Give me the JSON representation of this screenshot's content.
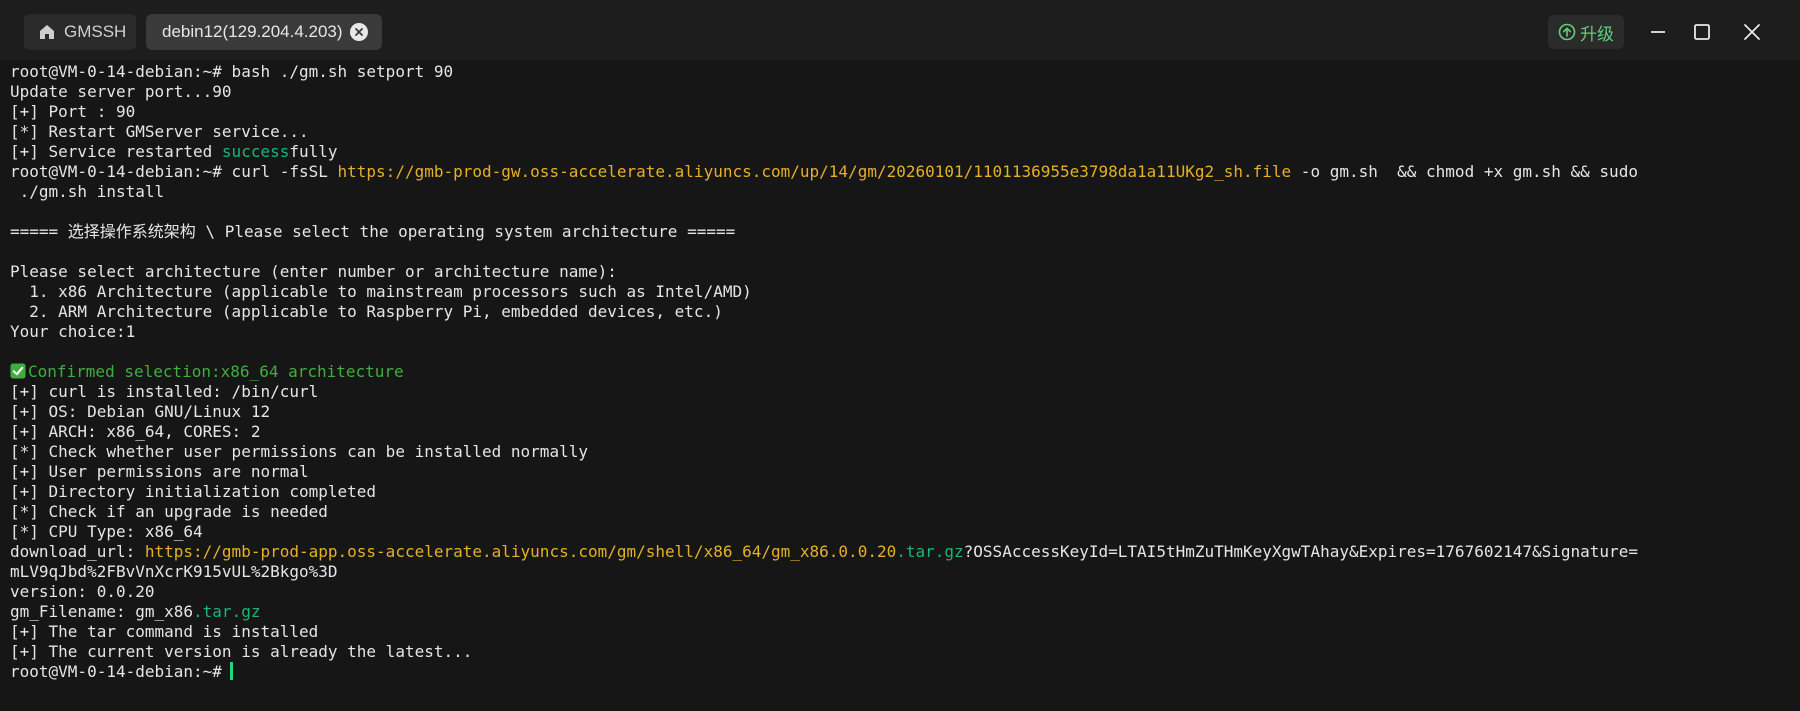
{
  "tabs": [
    {
      "label": "GMSSH",
      "icon": "home-icon"
    },
    {
      "label": "debin12(129.204.4.203)",
      "active": true
    }
  ],
  "toolbar": {
    "upgrade_label": "升级",
    "upgrade_color": "#5fd07a"
  },
  "colors": {
    "background": "#161616",
    "text": "#e5e5e5",
    "url": "#e5b027",
    "highlight_green": "#19b57a",
    "confirm_green": "#3fae3f",
    "cursor": "#1fd67f"
  },
  "terminal": {
    "lines": [
      {
        "segments": [
          {
            "text": "root@VM-0-14-debian:~# bash ./gm.sh setport 90"
          }
        ]
      },
      {
        "segments": [
          {
            "text": "Update server port...90"
          }
        ]
      },
      {
        "segments": [
          {
            "text": "[+] Port : 90"
          }
        ]
      },
      {
        "segments": [
          {
            "text": "[*] Restart GMServer service..."
          }
        ]
      },
      {
        "segments": [
          {
            "text": "[+] Service restarted "
          },
          {
            "text": "success",
            "style": "green"
          },
          {
            "text": "fully"
          }
        ]
      },
      {
        "segments": [
          {
            "text": "root@VM-0-14-debian:~# curl -fsSL "
          },
          {
            "text": "https://gmb-prod-gw.oss-accelerate.aliyuncs.com/up/14/gm/20260101/1101136955e3798da1a11UKg2_sh.file",
            "style": "url"
          },
          {
            "text": " -o gm.sh  && chmod +x gm.sh && sudo"
          }
        ]
      },
      {
        "segments": [
          {
            "text": " ./gm.sh install"
          }
        ]
      },
      {
        "segments": [
          {
            "text": ""
          }
        ]
      },
      {
        "segments": [
          {
            "text": "===== 选择操作系统架构 \\ Please select the operating system architecture ====="
          }
        ]
      },
      {
        "segments": [
          {
            "text": ""
          }
        ]
      },
      {
        "segments": [
          {
            "text": "Please select architecture (enter number or architecture name):"
          }
        ]
      },
      {
        "segments": [
          {
            "text": "  1. x86 Architecture (applicable to mainstream processors such as Intel/AMD)"
          }
        ]
      },
      {
        "segments": [
          {
            "text": "  2. ARM Architecture (applicable to Raspberry Pi, embedded devices, etc.)"
          }
        ]
      },
      {
        "segments": [
          {
            "text": "Your choice:1"
          }
        ]
      },
      {
        "segments": [
          {
            "text": ""
          }
        ]
      },
      {
        "icon": "check-mark-icon",
        "segments": [
          {
            "text": "Confirmed selection:x86_64 architecture",
            "style": "confirm"
          }
        ]
      },
      {
        "segments": [
          {
            "text": "[+] curl is installed: /bin/curl"
          }
        ]
      },
      {
        "segments": [
          {
            "text": "[+] OS: Debian GNU/Linux 12"
          }
        ]
      },
      {
        "segments": [
          {
            "text": "[+] ARCH: x86_64, CORES: 2"
          }
        ]
      },
      {
        "segments": [
          {
            "text": "[*] Check whether user permissions can be installed normally"
          }
        ]
      },
      {
        "segments": [
          {
            "text": "[+] User permissions are normal"
          }
        ]
      },
      {
        "segments": [
          {
            "text": "[+] Directory initialization completed"
          }
        ]
      },
      {
        "segments": [
          {
            "text": "[*] Check if an upgrade is needed"
          }
        ]
      },
      {
        "segments": [
          {
            "text": "[*] CPU Type: x86_64"
          }
        ]
      },
      {
        "segments": [
          {
            "text": "download_url: "
          },
          {
            "text": "https://gmb-prod-app.oss-accelerate.aliyuncs.com/gm/shell/x86_64/gm_x86.0.0.20",
            "style": "url"
          },
          {
            "text": ".tar.gz",
            "style": "green"
          },
          {
            "text": "?OSSAccessKeyId=LTAI5tHmZuTHmKeyXgwTAhay&Expires=1767602147&Signature="
          }
        ]
      },
      {
        "segments": [
          {
            "text": "mLV9qJbd%2FBvVnXcrK915vUL%2Bkgo%3D"
          }
        ]
      },
      {
        "segments": [
          {
            "text": "version: 0.0.20"
          }
        ]
      },
      {
        "segments": [
          {
            "text": "gm_Filename: gm_x86"
          },
          {
            "text": ".tar.gz",
            "style": "green"
          }
        ]
      },
      {
        "segments": [
          {
            "text": "[+] The tar command is installed"
          }
        ]
      },
      {
        "segments": [
          {
            "text": "[+] The current version is already the latest..."
          }
        ]
      },
      {
        "cursor": true,
        "segments": [
          {
            "text": "root@VM-0-14-debian:~#"
          }
        ]
      }
    ]
  }
}
